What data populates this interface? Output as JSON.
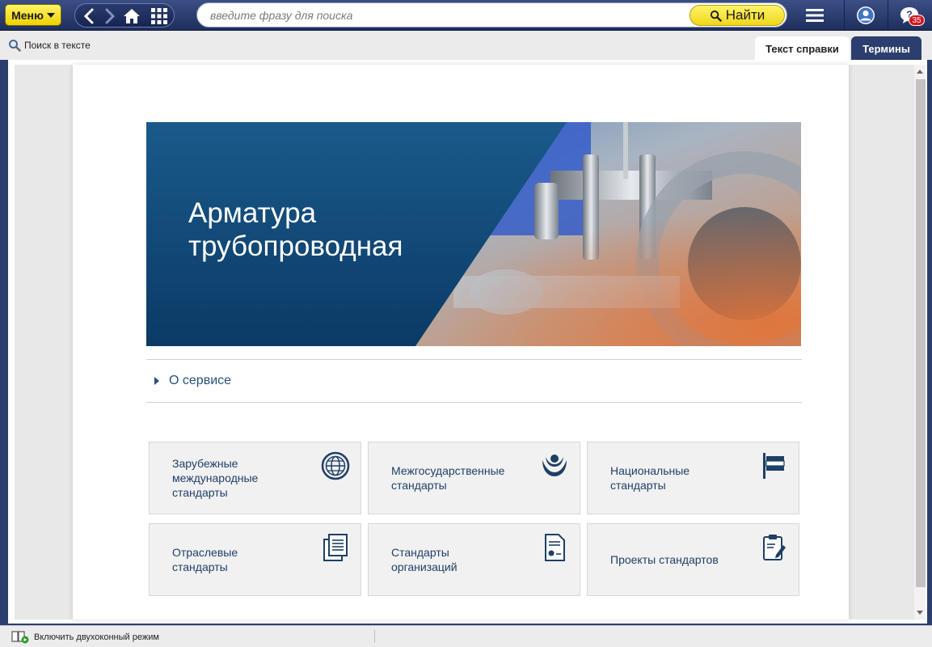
{
  "topbar": {
    "menu_label": "Меню",
    "search_placeholder": "введите фразу для поиска",
    "find_label": "Найти",
    "notifications_count": "35"
  },
  "toolbar": {
    "find_in_text": "Поиск в тексте",
    "tabs": [
      {
        "label": "Текст справки",
        "active": true
      },
      {
        "label": "Термины",
        "active": false
      }
    ]
  },
  "banner": {
    "title_line1": "Арматура",
    "title_line2": "трубопроводная"
  },
  "about": {
    "label": "О сервисе"
  },
  "cards": [
    {
      "label": "Зарубежные международные стандарты",
      "icon": "globe-icon"
    },
    {
      "label": "Межгосударственные стандарты",
      "icon": "cis-emblem-icon"
    },
    {
      "label": "Национальные стандарты",
      "icon": "flag-icon"
    },
    {
      "label": "Отраслевые стандарты",
      "icon": "documents-icon"
    },
    {
      "label": "Стандарты организаций",
      "icon": "certificate-icon"
    },
    {
      "label": "Проекты стандартов",
      "icon": "clipboard-edit-icon"
    }
  ],
  "statusbar": {
    "two_window_label": "Включить двухоконный режим"
  },
  "colors": {
    "topbar": "#2c3e6e",
    "accent_yellow": "#f0d200",
    "link_blue": "#1e3f66",
    "banner_blue": "#0f4a78",
    "badge_red": "#d5141b"
  }
}
